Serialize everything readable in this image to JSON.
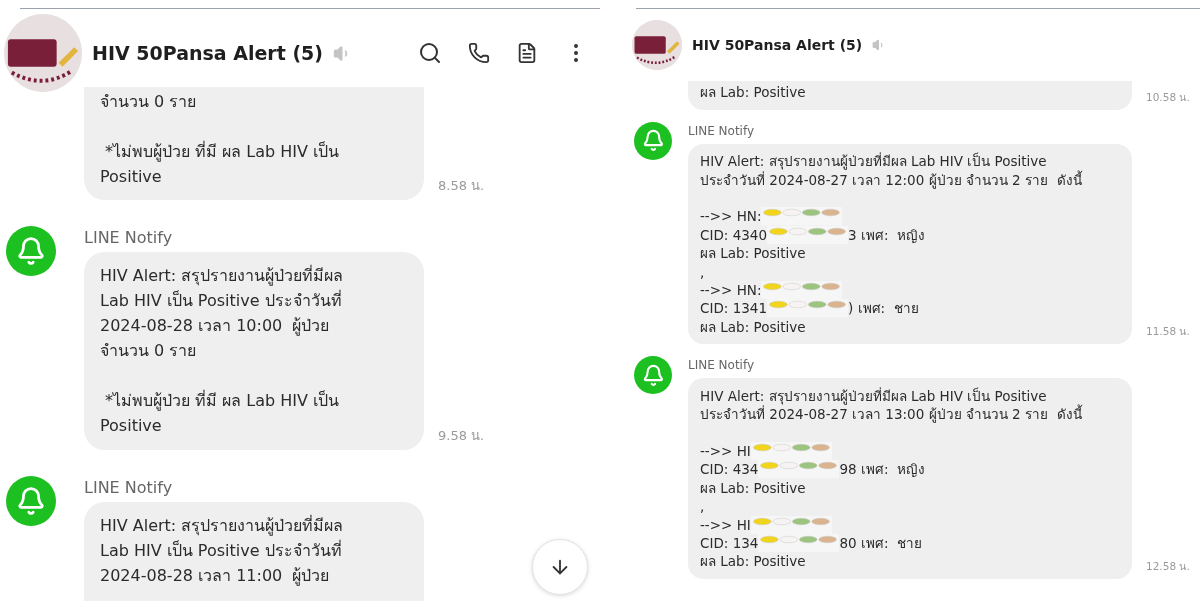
{
  "panels": [
    {
      "kind": "large",
      "title": "HIV 50Pansa Alert (5)",
      "muted": true,
      "show_actions": true,
      "scroll_down_button": true,
      "messages": [
        {
          "cut_top": true,
          "cut_bottom": false,
          "time": "8.58 น.",
          "lines": [
            {
              "kind": "text",
              "text": "จำนวน 0 ราย"
            },
            {
              "kind": "gap"
            },
            {
              "kind": "text",
              "text": " *ไม่พบผู้ป่วย ที่มี ผล Lab HIV เป็น"
            },
            {
              "kind": "text",
              "text": "Positive"
            }
          ]
        },
        {
          "sender": "LINE Notify",
          "cut_top": false,
          "cut_bottom": false,
          "time": "9.58 น.",
          "lines": [
            {
              "kind": "text",
              "text": "HIV Alert: สรุปรายงานผู้ป่วยที่มีผล"
            },
            {
              "kind": "text",
              "text": "Lab HIV เป็น Positive ประจำวันที่"
            },
            {
              "kind": "text",
              "text": "2024-08-28 เวลา 10:00  ผู้ป่วย"
            },
            {
              "kind": "text",
              "text": "จำนวน 0 ราย"
            },
            {
              "kind": "gap"
            },
            {
              "kind": "text",
              "text": " *ไม่พบผู้ป่วย ที่มี ผล Lab HIV เป็น"
            },
            {
              "kind": "text",
              "text": "Positive"
            }
          ]
        },
        {
          "sender": "LINE Notify",
          "cut_top": false,
          "cut_bottom": true,
          "lines": [
            {
              "kind": "text",
              "text": "HIV Alert: สรุปรายงานผู้ป่วยที่มีผล"
            },
            {
              "kind": "text",
              "text": "Lab HIV เป็น Positive ประจำวันที่"
            },
            {
              "kind": "text",
              "text": "2024-08-28 เวลา 11:00  ผู้ป่วย"
            }
          ]
        }
      ]
    },
    {
      "kind": "compact",
      "title": "HIV 50Pansa Alert (5)",
      "muted": true,
      "messages": [
        {
          "cut_top": true,
          "cut_bottom": false,
          "time": "10.58 น.",
          "lines": [
            {
              "kind": "text",
              "text": "ผล Lab: Positive"
            }
          ]
        },
        {
          "sender": "LINE Notify",
          "cut_top": false,
          "cut_bottom": false,
          "time": "11.58 น.",
          "lines": [
            {
              "kind": "text",
              "text": "HIV Alert: สรุปรายงานผู้ป่วยที่มีผล Lab HIV เป็น Positive"
            },
            {
              "kind": "text",
              "text": "ประจำวันที่ 2024-08-27 เวลา 12:00 ผู้ป่วย จำนวน 2 ราย  ดังนี้"
            },
            {
              "kind": "gap"
            },
            {
              "kind": "redacted",
              "text": "-->> HN:"
            },
            {
              "kind": "redacted",
              "text": "CID: 4340",
              "after": "3 เพศ:  หญิง"
            },
            {
              "kind": "text",
              "text": "ผล Lab: Positive"
            },
            {
              "kind": "text",
              "text": ","
            },
            {
              "kind": "redacted",
              "text": "-->> HN:"
            },
            {
              "kind": "redacted",
              "text": "CID: 1341",
              "after": ") เพศ:  ชาย"
            },
            {
              "kind": "text",
              "text": "ผล Lab: Positive"
            }
          ]
        },
        {
          "sender": "LINE Notify",
          "cut_top": false,
          "cut_bottom": false,
          "time": "12.58 น.",
          "lines": [
            {
              "kind": "text",
              "text": "HIV Alert: สรุปรายงานผู้ป่วยที่มีผล Lab HIV เป็น Positive"
            },
            {
              "kind": "text",
              "text": "ประจำวันที่ 2024-08-27 เวลา 13:00 ผู้ป่วย จำนวน 2 ราย  ดังนี้"
            },
            {
              "kind": "gap"
            },
            {
              "kind": "redacted",
              "text": "-->> HI"
            },
            {
              "kind": "redacted",
              "text": "CID: 434",
              "after": "98 เพศ:  หญิง"
            },
            {
              "kind": "text",
              "text": "ผล Lab: Positive"
            },
            {
              "kind": "text",
              "text": ","
            },
            {
              "kind": "redacted",
              "text": "-->> HI"
            },
            {
              "kind": "redacted",
              "text": "CID: 134",
              "after": "80 เพศ:  ชาย"
            },
            {
              "kind": "text",
              "text": "ผล Lab: Positive"
            }
          ]
        }
      ]
    }
  ]
}
